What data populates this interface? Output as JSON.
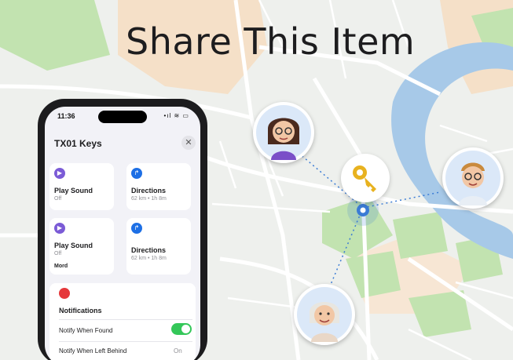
{
  "headline": "Share This Item",
  "phone": {
    "status": {
      "time": "11:36",
      "icons": "•ıl ≋ ▭"
    },
    "sheet_title": "TX01 Keys",
    "close_glyph": "✕",
    "cards": [
      {
        "title": "Play Sound",
        "sub": "Off",
        "icon": "play-icon",
        "glyph": "▶"
      },
      {
        "title": "Directions",
        "sub": "62 km • 1h 8m",
        "icon": "directions-icon",
        "glyph": "↱"
      },
      {
        "title": "Play Sound",
        "sub": "Off",
        "extra": "Mord",
        "icon": "play-icon",
        "glyph": "▶"
      },
      {
        "title": "Directions",
        "sub": "62 km • 1h 8m",
        "icon": "directions-icon",
        "glyph": "↱"
      }
    ],
    "notifications": {
      "heading": "Notifications",
      "notify_found": "Notify When Found",
      "notify_left": "Notify When Left Behind",
      "notify_left_value": "On",
      "notify_found_on": true
    }
  },
  "colors": {
    "accent": "#1d6fe5",
    "toggle_on": "#34c759",
    "alert": "#e5383b",
    "river": "#a7c9e8",
    "park": "#c2e3b0"
  },
  "avatars": [
    "woman-with-glasses-avatar",
    "man-with-glasses-avatar",
    "older-woman-avatar"
  ],
  "item_pin": "key-icon"
}
